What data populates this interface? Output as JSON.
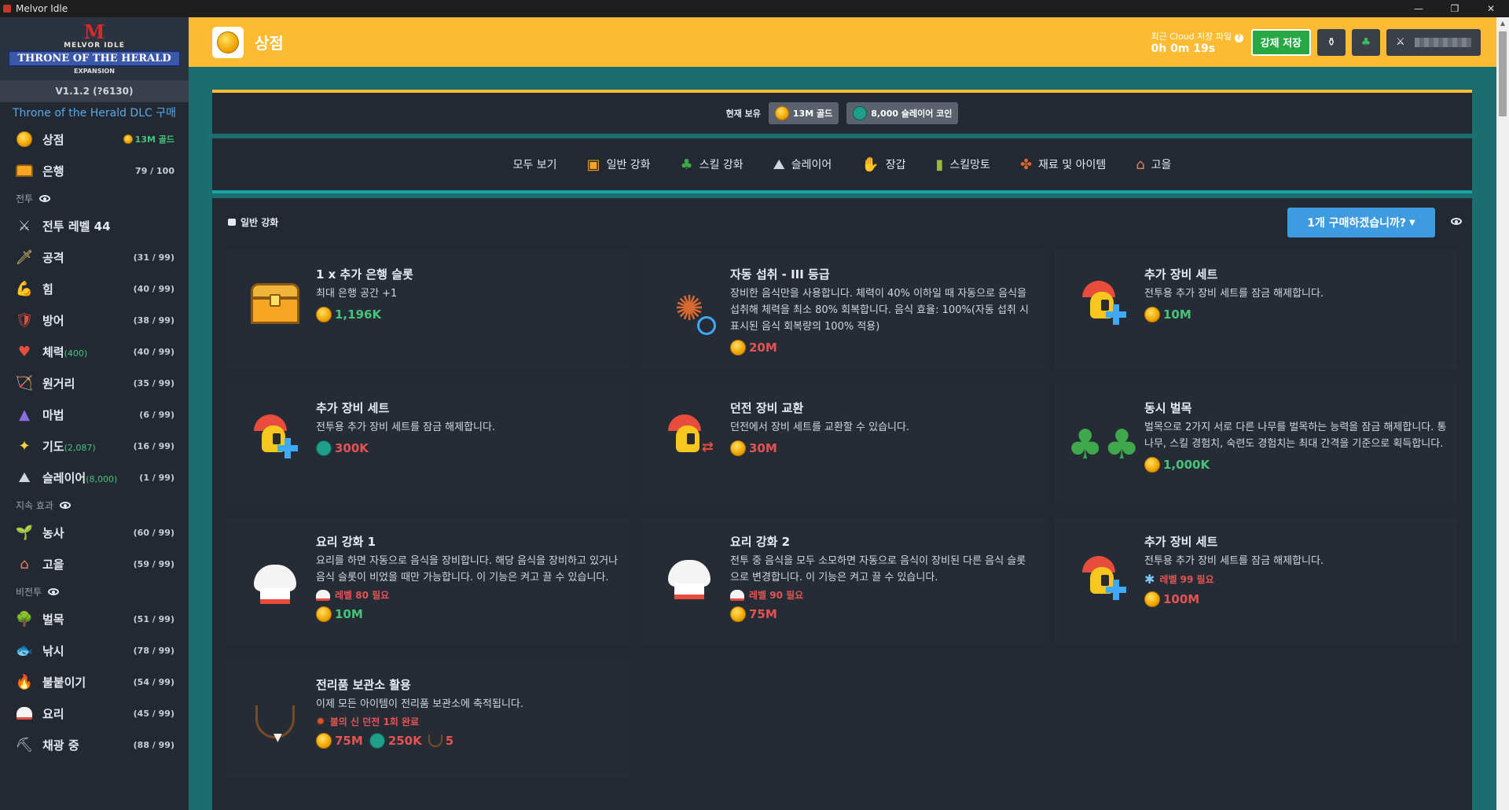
{
  "window": {
    "title": "Melvor Idle",
    "controls": [
      "—",
      "❐",
      "✕"
    ]
  },
  "logo": {
    "top": "M",
    "brand": "MELVOR IDLE",
    "banner": "THRONE OF THE HERALD",
    "expansion": "EXPANSION"
  },
  "sidebar": {
    "version": "V1.1.2 (?6130)",
    "dlc_link": "Throne of the Herald DLC 구매",
    "top_items": [
      {
        "label": "상점",
        "right": "13M 골드",
        "icon": "coin-icon"
      },
      {
        "label": "은행",
        "right": "79 / 100",
        "icon": "bank-chest-icon"
      }
    ],
    "sections": {
      "combat": "전투",
      "passive": "지속 효과",
      "noncombat": "비전투"
    },
    "combat_items": [
      {
        "label": "전투 레벨 44",
        "sub": "",
        "right": "",
        "icon": "crossed-swords-icon"
      },
      {
        "label": "공격",
        "sub": "",
        "right": "(31 / 99)",
        "icon": "sword-icon"
      },
      {
        "label": "힘",
        "sub": "",
        "right": "(40 / 99)",
        "icon": "arm-icon"
      },
      {
        "label": "방어",
        "sub": "",
        "right": "(38 / 99)",
        "icon": "shield-icon"
      },
      {
        "label": "체력",
        "sub": "(400)",
        "right": "(40 / 99)",
        "icon": "heart-icon"
      },
      {
        "label": "원거리",
        "sub": "",
        "right": "(35 / 99)",
        "icon": "bow-icon"
      },
      {
        "label": "마법",
        "sub": "",
        "right": "(6 / 99)",
        "icon": "wizard-hat-icon"
      },
      {
        "label": "기도",
        "sub": "(2,087)",
        "right": "(16 / 99)",
        "icon": "sparkle-icon"
      },
      {
        "label": "슬레이어",
        "sub": "(8,000)",
        "right": "(1 / 99)",
        "icon": "slayer-icon"
      }
    ],
    "passive_items": [
      {
        "label": "농사",
        "right": "(60 / 99)",
        "icon": "sprout-icon"
      },
      {
        "label": "고을",
        "right": "(59 / 99)",
        "icon": "township-icon"
      }
    ],
    "noncombat_items": [
      {
        "label": "벌목",
        "right": "(51 / 99)",
        "icon": "tree-icon"
      },
      {
        "label": "낚시",
        "right": "(78 / 99)",
        "icon": "fish-icon"
      },
      {
        "label": "불붙이기",
        "right": "(54 / 99)",
        "icon": "fire-icon"
      },
      {
        "label": "요리",
        "right": "(45 / 99)",
        "icon": "chef-hat-icon"
      },
      {
        "label": "채광 중",
        "right": "(88 / 99)",
        "icon": "pickaxe-icon"
      }
    ]
  },
  "header": {
    "title": "상점",
    "cloud_label": "최근 Cloud 저장 파일",
    "cloud_time": "0h 0m 19s",
    "save_button": "강제 저장"
  },
  "currency": {
    "label": "현재 보유",
    "gold": "13M 골드",
    "slayer": "8,000 슬레이어 코인"
  },
  "tabs": [
    {
      "label": "모두 보기",
      "icon": ""
    },
    {
      "label": "일반 강화",
      "icon": "chest-icon"
    },
    {
      "label": "스킬 강화",
      "icon": "tree-icon"
    },
    {
      "label": "슬레이어",
      "icon": "slayer-icon"
    },
    {
      "label": "장갑",
      "icon": "glove-icon"
    },
    {
      "label": "스킬망토",
      "icon": "cape-icon"
    },
    {
      "label": "재료 및 아이템",
      "icon": "leather-icon"
    },
    {
      "label": "고을",
      "icon": "township-icon"
    }
  ],
  "category": {
    "title": "일반 강화",
    "buy_button": "1개 구매하겠습니까?"
  },
  "items": [
    {
      "name": "1 x 추가 은행 슬롯",
      "desc": "최대 은행 공간 +1",
      "req": "",
      "costs": [
        {
          "type": "gold",
          "value": "1,196K",
          "color": "green"
        }
      ]
    },
    {
      "name": "자동 섭취 - III 등급",
      "desc": "장비한 음식만을 사용합니다. 체력이 40% 이하일 때 자동으로 음식을 섭취해 체력을 최소 80% 회복합니다. 음식 효율: 100%(자동 섭취 시 표시된 음식 회복량의 100% 적용)",
      "req": "",
      "costs": [
        {
          "type": "gold",
          "value": "20M",
          "color": "red"
        }
      ]
    },
    {
      "name": "추가 장비 세트",
      "desc": "전투용 추가 장비 세트를 잠금 해제합니다.",
      "req": "",
      "costs": [
        {
          "type": "gold",
          "value": "10M",
          "color": "green"
        }
      ]
    },
    {
      "name": "추가 장비 세트",
      "desc": "전투용 추가 장비 세트를 잠금 해제합니다.",
      "req": "",
      "costs": [
        {
          "type": "slayer",
          "value": "300K",
          "color": "red"
        }
      ]
    },
    {
      "name": "던전 장비 교환",
      "desc": "던전에서 장비 세트를 교환할 수 있습니다.",
      "req": "",
      "costs": [
        {
          "type": "gold",
          "value": "30M",
          "color": "red"
        }
      ]
    },
    {
      "name": "동시 벌목",
      "desc": "벌목으로 2가지 서로 다른 나무를 벌목하는 능력을 잠금 해제합니다. 통나무, 스킬 경험치, 숙련도 경험치는 최대 간격을 기준으로 획득합니다.",
      "req": "",
      "costs": [
        {
          "type": "gold",
          "value": "1,000K",
          "color": "green"
        }
      ]
    },
    {
      "name": "요리 강화 1",
      "desc": "요리를 하면 자동으로 음식을 장비합니다. 해당 음식을 장비하고 있거나 음식 슬롯이 비었을 때만 가능합니다. 이 기능은 켜고 끌 수 있습니다.",
      "req": "레벨 80 필요",
      "costs": [
        {
          "type": "gold",
          "value": "10M",
          "color": "green"
        }
      ]
    },
    {
      "name": "요리 강화 2",
      "desc": "전투 중 음식을 모두 소모하면 자동으로 음식이 장비된 다른 음식 슬롯으로 변경합니다. 이 기능은 켜고 끌 수 있습니다.",
      "req": "레벨 90 필요",
      "costs": [
        {
          "type": "gold",
          "value": "75M",
          "color": "red"
        }
      ]
    },
    {
      "name": "추가 장비 세트",
      "desc": "전투용 추가 장비 세트를 잠금 해제합니다.",
      "req": "레벨 99 필요",
      "costs": [
        {
          "type": "gold",
          "value": "100M",
          "color": "red"
        }
      ]
    },
    {
      "name": "전리품 보관소 활용",
      "desc": "이제 모든 아이템이 전리품 보관소에 축적됩니다.",
      "req": "불의 신 던전 1회 완료",
      "costs": [
        {
          "type": "gold",
          "value": "75M",
          "color": "red"
        },
        {
          "type": "slayer",
          "value": "250K",
          "color": "red"
        },
        {
          "type": "necklace",
          "value": "5",
          "color": "red"
        }
      ]
    }
  ]
}
